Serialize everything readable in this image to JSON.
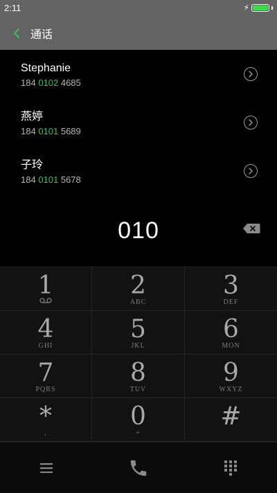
{
  "status_bar": {
    "time": "2:11",
    "battery_level": 1.0,
    "charging": true
  },
  "header": {
    "title": "通话",
    "back_icon": "chevron-left-icon"
  },
  "contacts": [
    {
      "name": "Stephanie",
      "number_pre": "184 ",
      "number_match": "0102",
      "number_post": " 4685"
    },
    {
      "name": "燕婷",
      "number_pre": "184 ",
      "number_match": "0101",
      "number_post": " 5689"
    },
    {
      "name": "子玲",
      "number_pre": "184 ",
      "number_match": "0101",
      "number_post": " 5678"
    }
  ],
  "dialer": {
    "input": "010"
  },
  "keypad": [
    {
      "digit": "1",
      "letters": ""
    },
    {
      "digit": "2",
      "letters": "ABC"
    },
    {
      "digit": "3",
      "letters": "DEF"
    },
    {
      "digit": "4",
      "letters": "GHI"
    },
    {
      "digit": "5",
      "letters": "JKL"
    },
    {
      "digit": "6",
      "letters": "MON"
    },
    {
      "digit": "7",
      "letters": "PQRS"
    },
    {
      "digit": "8",
      "letters": "TUV"
    },
    {
      "digit": "9",
      "letters": "WXYZ"
    },
    {
      "digit": "*",
      "letters": ","
    },
    {
      "digit": "0",
      "letters": "+"
    },
    {
      "digit": "#",
      "letters": ""
    }
  ],
  "bottom_bar": {
    "icons": [
      "menu-icon",
      "phone-icon",
      "dialpad-icon"
    ]
  },
  "colors": {
    "header_bg": "#636363",
    "match_green": "#3cc35a",
    "battery_green": "#3fdc4e"
  }
}
